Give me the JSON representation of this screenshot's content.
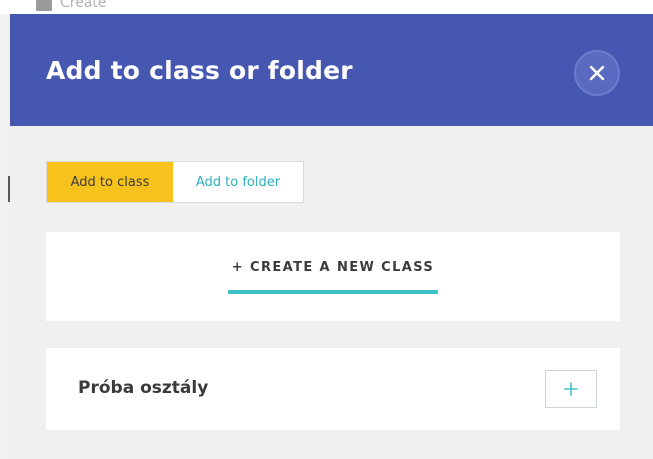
{
  "background": {
    "create_label": "Create"
  },
  "modal": {
    "title": "Add to class or folder",
    "close_icon": "close-icon",
    "tabs": [
      {
        "label": "Add to class",
        "active": true
      },
      {
        "label": "Add to folder",
        "active": false
      }
    ],
    "create_new_class_label": "+ CREATE A NEW CLASS",
    "classes": [
      {
        "name": "Próba osztály",
        "action_icon": "plus-icon"
      }
    ]
  },
  "colors": {
    "header": "#4657b2",
    "active_tab": "#f7c21c",
    "accent_teal": "#3dc2c9",
    "tab_text_teal": "#2ab0be",
    "panel_bg": "#f0f0f0"
  }
}
